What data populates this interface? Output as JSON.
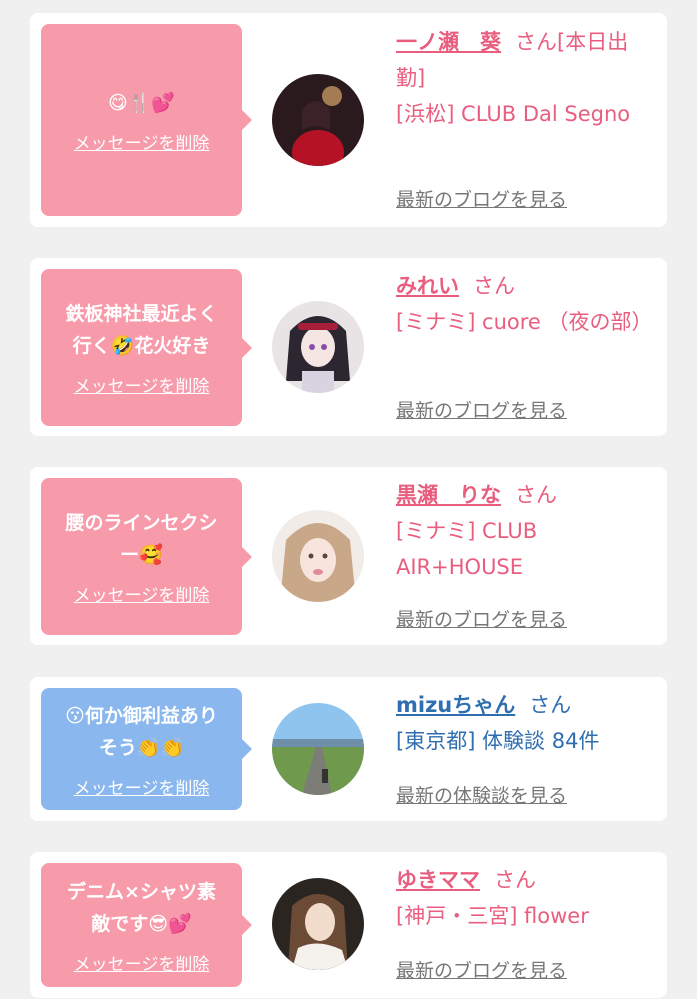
{
  "colors": {
    "pink_bubble": "#f79bab",
    "blue_bubble": "#8ab8ee",
    "pink_text": "#e95e7e",
    "blue_text": "#2f6eaf",
    "link_gray": "#777777"
  },
  "cards": [
    {
      "message": "😋🍴💕",
      "delete_label": "メッセージを削除",
      "name": "一ノ瀬　葵",
      "honorific": "さん[本日出勤]",
      "shop": "[浜松] CLUB Dal Segno",
      "blog_link": "最新のブログを見る"
    },
    {
      "message": "鉄板神社最近よく\n行く🤣花火好き",
      "delete_label": "メッセージを削除",
      "name": "みれい",
      "honorific": "さん",
      "shop": "[ミナミ] cuore （夜の部）",
      "blog_link": "最新のブログを見る"
    },
    {
      "message": "腰のラインセクシ\nー🥰",
      "delete_label": "メッセージを削除",
      "name": "黒瀬　りな",
      "honorific": "さん",
      "shop": "[ミナミ] CLUB AIR+HOUSE",
      "blog_link": "最新のブログを見る"
    },
    {
      "message": "😗何か御利益あり\nそう👏👏",
      "delete_label": "メッセージを削除",
      "name": "mizuちゃん",
      "honorific": "さん",
      "shop": "[東京都] 体験談 84件",
      "blog_link": "最新の体験談を見る"
    },
    {
      "message": "デニム×シャツ素\n敵です😎💕",
      "delete_label": "メッセージを削除",
      "name": "ゆきママ",
      "honorific": "さん",
      "shop": "[神戸・三宮] flower",
      "blog_link": "最新のブログを見る"
    }
  ]
}
